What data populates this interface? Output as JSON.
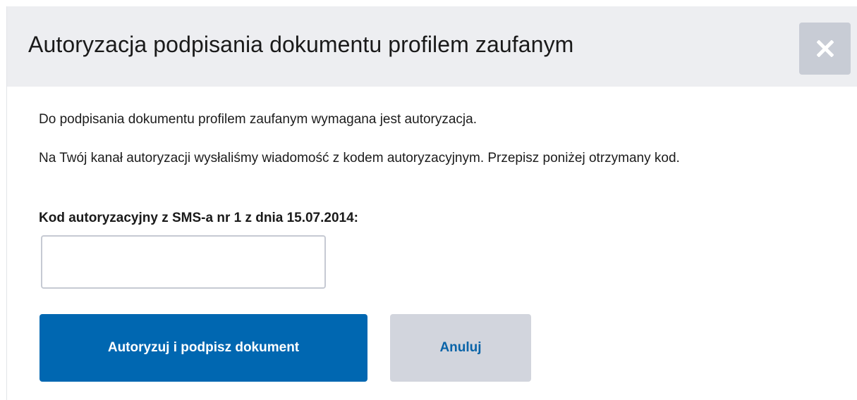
{
  "dialog": {
    "title": "Autoryzacja podpisania dokumentu profilem zaufanym",
    "close_icon": "close-icon",
    "paragraph1": "Do podpisania dokumentu profilem zaufanym wymagana jest autoryzacja.",
    "paragraph2": "Na Twój kanał autoryzacji wysłaliśmy wiadomość z kodem autoryzacyjnym. Przepisz poniżej otrzymany kod.",
    "code_label": "Kod autoryzacyjny z SMS-a nr 1 z dnia 15.07.2014:",
    "code_value": "",
    "submit_label": "Autoryzuj i podpisz dokument",
    "cancel_label": "Anuluj"
  },
  "colors": {
    "header_bg": "#edeef1",
    "primary": "#0067b1",
    "secondary_bg": "#d2d5dd",
    "close_bg": "#c8ccd5"
  }
}
